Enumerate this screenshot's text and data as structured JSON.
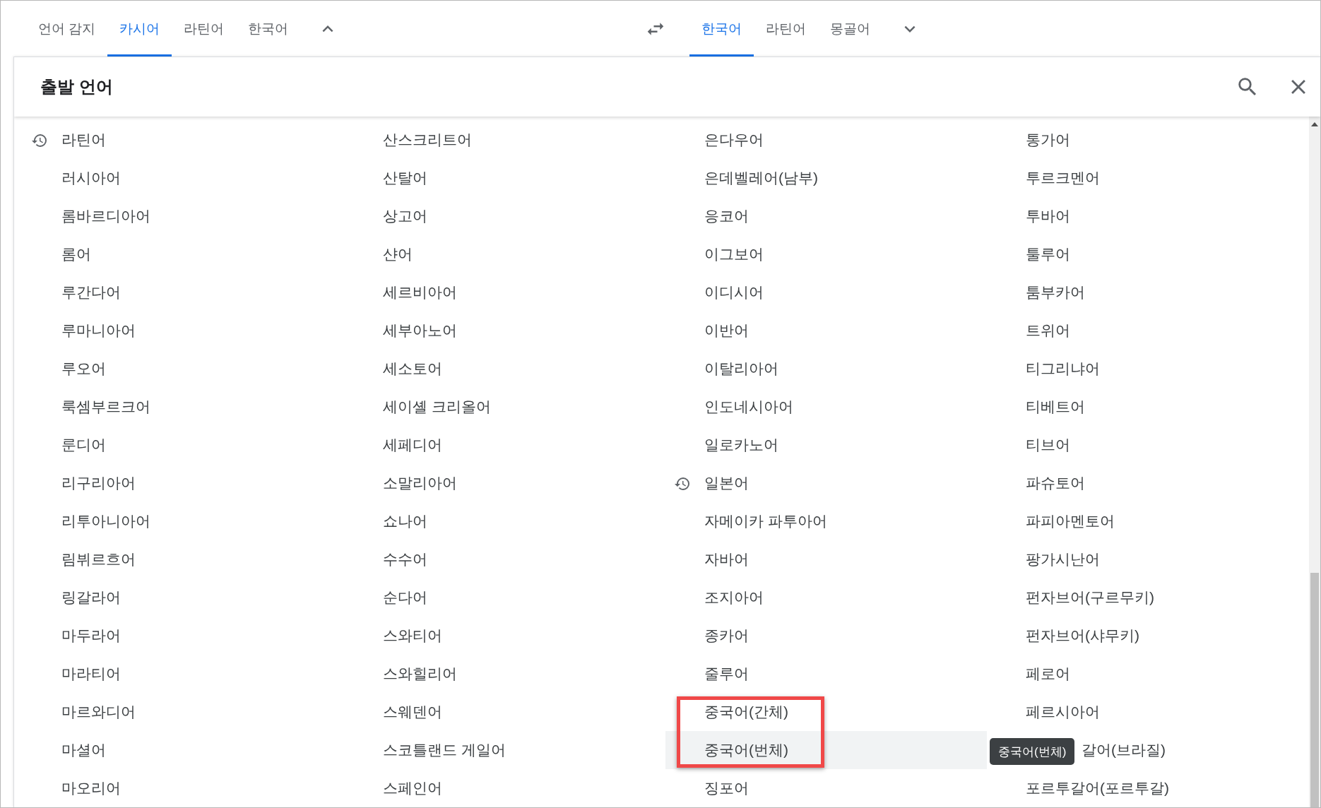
{
  "source_tabs": [
    {
      "label": "언어 감지",
      "selected": false
    },
    {
      "label": "카시어",
      "selected": true
    },
    {
      "label": "라틴어",
      "selected": false
    },
    {
      "label": "한국어",
      "selected": false
    }
  ],
  "target_tabs": [
    {
      "label": "한국어",
      "selected": true
    },
    {
      "label": "라틴어",
      "selected": false
    },
    {
      "label": "몽골어",
      "selected": false
    }
  ],
  "panel": {
    "title": "출발 언어"
  },
  "columns": [
    [
      {
        "label": "라틴어",
        "recent": true,
        "hovered": false,
        "boxed": false,
        "clipped": false
      },
      {
        "label": "러시아어",
        "recent": false,
        "hovered": false,
        "boxed": false,
        "clipped": false
      },
      {
        "label": "롬바르디아어",
        "recent": false,
        "hovered": false,
        "boxed": false,
        "clipped": false
      },
      {
        "label": "롬어",
        "recent": false,
        "hovered": false,
        "boxed": false,
        "clipped": false
      },
      {
        "label": "루간다어",
        "recent": false,
        "hovered": false,
        "boxed": false,
        "clipped": false
      },
      {
        "label": "루마니아어",
        "recent": false,
        "hovered": false,
        "boxed": false,
        "clipped": false
      },
      {
        "label": "루오어",
        "recent": false,
        "hovered": false,
        "boxed": false,
        "clipped": false
      },
      {
        "label": "룩셈부르크어",
        "recent": false,
        "hovered": false,
        "boxed": false,
        "clipped": false
      },
      {
        "label": "룬디어",
        "recent": false,
        "hovered": false,
        "boxed": false,
        "clipped": false
      },
      {
        "label": "리구리아어",
        "recent": false,
        "hovered": false,
        "boxed": false,
        "clipped": false
      },
      {
        "label": "리투아니아어",
        "recent": false,
        "hovered": false,
        "boxed": false,
        "clipped": false
      },
      {
        "label": "림뷔르흐어",
        "recent": false,
        "hovered": false,
        "boxed": false,
        "clipped": false
      },
      {
        "label": "링갈라어",
        "recent": false,
        "hovered": false,
        "boxed": false,
        "clipped": false
      },
      {
        "label": "마두라어",
        "recent": false,
        "hovered": false,
        "boxed": false,
        "clipped": false
      },
      {
        "label": "마라티어",
        "recent": false,
        "hovered": false,
        "boxed": false,
        "clipped": false
      },
      {
        "label": "마르와디어",
        "recent": false,
        "hovered": false,
        "boxed": false,
        "clipped": false
      },
      {
        "label": "마셜어",
        "recent": false,
        "hovered": false,
        "boxed": false,
        "clipped": false
      },
      {
        "label": "마오리어",
        "recent": false,
        "hovered": false,
        "boxed": false,
        "clipped": false
      }
    ],
    [
      {
        "label": "산스크리트어",
        "recent": false,
        "hovered": false,
        "boxed": false,
        "clipped": false
      },
      {
        "label": "산탈어",
        "recent": false,
        "hovered": false,
        "boxed": false,
        "clipped": false
      },
      {
        "label": "상고어",
        "recent": false,
        "hovered": false,
        "boxed": false,
        "clipped": false
      },
      {
        "label": "샨어",
        "recent": false,
        "hovered": false,
        "boxed": false,
        "clipped": false
      },
      {
        "label": "세르비아어",
        "recent": false,
        "hovered": false,
        "boxed": false,
        "clipped": false
      },
      {
        "label": "세부아노어",
        "recent": false,
        "hovered": false,
        "boxed": false,
        "clipped": false
      },
      {
        "label": "세소토어",
        "recent": false,
        "hovered": false,
        "boxed": false,
        "clipped": false
      },
      {
        "label": "세이셸 크리올어",
        "recent": false,
        "hovered": false,
        "boxed": false,
        "clipped": false
      },
      {
        "label": "세페디어",
        "recent": false,
        "hovered": false,
        "boxed": false,
        "clipped": false
      },
      {
        "label": "소말리아어",
        "recent": false,
        "hovered": false,
        "boxed": false,
        "clipped": false
      },
      {
        "label": "쇼나어",
        "recent": false,
        "hovered": false,
        "boxed": false,
        "clipped": false
      },
      {
        "label": "수수어",
        "recent": false,
        "hovered": false,
        "boxed": false,
        "clipped": false
      },
      {
        "label": "순다어",
        "recent": false,
        "hovered": false,
        "boxed": false,
        "clipped": false
      },
      {
        "label": "스와티어",
        "recent": false,
        "hovered": false,
        "boxed": false,
        "clipped": false
      },
      {
        "label": "스와힐리어",
        "recent": false,
        "hovered": false,
        "boxed": false,
        "clipped": false
      },
      {
        "label": "스웨덴어",
        "recent": false,
        "hovered": false,
        "boxed": false,
        "clipped": false
      },
      {
        "label": "스코틀랜드 게일어",
        "recent": false,
        "hovered": false,
        "boxed": false,
        "clipped": false
      },
      {
        "label": "스페인어",
        "recent": false,
        "hovered": false,
        "boxed": false,
        "clipped": false
      }
    ],
    [
      {
        "label": "은다우어",
        "recent": false,
        "hovered": false,
        "boxed": false,
        "clipped": false
      },
      {
        "label": "은데벨레어(남부)",
        "recent": false,
        "hovered": false,
        "boxed": false,
        "clipped": false
      },
      {
        "label": "응코어",
        "recent": false,
        "hovered": false,
        "boxed": false,
        "clipped": false
      },
      {
        "label": "이그보어",
        "recent": false,
        "hovered": false,
        "boxed": false,
        "clipped": false
      },
      {
        "label": "이디시어",
        "recent": false,
        "hovered": false,
        "boxed": false,
        "clipped": false
      },
      {
        "label": "이반어",
        "recent": false,
        "hovered": false,
        "boxed": false,
        "clipped": false
      },
      {
        "label": "이탈리아어",
        "recent": false,
        "hovered": false,
        "boxed": false,
        "clipped": false
      },
      {
        "label": "인도네시아어",
        "recent": false,
        "hovered": false,
        "boxed": false,
        "clipped": false
      },
      {
        "label": "일로카노어",
        "recent": false,
        "hovered": false,
        "boxed": false,
        "clipped": false
      },
      {
        "label": "일본어",
        "recent": true,
        "hovered": false,
        "boxed": false,
        "clipped": false
      },
      {
        "label": "자메이카 파투아어",
        "recent": false,
        "hovered": false,
        "boxed": false,
        "clipped": false
      },
      {
        "label": "자바어",
        "recent": false,
        "hovered": false,
        "boxed": false,
        "clipped": false
      },
      {
        "label": "조지아어",
        "recent": false,
        "hovered": false,
        "boxed": false,
        "clipped": false
      },
      {
        "label": "종카어",
        "recent": false,
        "hovered": false,
        "boxed": false,
        "clipped": false
      },
      {
        "label": "줄루어",
        "recent": false,
        "hovered": false,
        "boxed": false,
        "clipped": false
      },
      {
        "label": "중국어(간체)",
        "recent": false,
        "hovered": false,
        "boxed": true,
        "clipped": false
      },
      {
        "label": "중국어(번체)",
        "recent": false,
        "hovered": true,
        "boxed": true,
        "clipped": false,
        "tooltip": "중국어(번체)"
      },
      {
        "label": "징포어",
        "recent": false,
        "hovered": false,
        "boxed": false,
        "clipped": false
      }
    ],
    [
      {
        "label": "통가어",
        "recent": false,
        "hovered": false,
        "boxed": false,
        "clipped": false
      },
      {
        "label": "투르크멘어",
        "recent": false,
        "hovered": false,
        "boxed": false,
        "clipped": false
      },
      {
        "label": "투바어",
        "recent": false,
        "hovered": false,
        "boxed": false,
        "clipped": false
      },
      {
        "label": "툴루어",
        "recent": false,
        "hovered": false,
        "boxed": false,
        "clipped": false
      },
      {
        "label": "툼부카어",
        "recent": false,
        "hovered": false,
        "boxed": false,
        "clipped": false
      },
      {
        "label": "트위어",
        "recent": false,
        "hovered": false,
        "boxed": false,
        "clipped": false
      },
      {
        "label": "티그리냐어",
        "recent": false,
        "hovered": false,
        "boxed": false,
        "clipped": false
      },
      {
        "label": "티베트어",
        "recent": false,
        "hovered": false,
        "boxed": false,
        "clipped": false
      },
      {
        "label": "티브어",
        "recent": false,
        "hovered": false,
        "boxed": false,
        "clipped": false
      },
      {
        "label": "파슈토어",
        "recent": false,
        "hovered": false,
        "boxed": false,
        "clipped": false
      },
      {
        "label": "파피아멘토어",
        "recent": false,
        "hovered": false,
        "boxed": false,
        "clipped": false
      },
      {
        "label": "팡가시난어",
        "recent": false,
        "hovered": false,
        "boxed": false,
        "clipped": false
      },
      {
        "label": "펀자브어(구르무키)",
        "recent": false,
        "hovered": false,
        "boxed": false,
        "clipped": false
      },
      {
        "label": "펀자브어(샤무키)",
        "recent": false,
        "hovered": false,
        "boxed": false,
        "clipped": false
      },
      {
        "label": "페로어",
        "recent": false,
        "hovered": false,
        "boxed": false,
        "clipped": false
      },
      {
        "label": "페르시아어",
        "recent": false,
        "hovered": false,
        "boxed": false,
        "clipped": false
      },
      {
        "label": "갈어(브라질)",
        "recent": false,
        "hovered": false,
        "boxed": false,
        "clipped": true
      },
      {
        "label": "포르투갈어(포르투갈)",
        "recent": false,
        "hovered": false,
        "boxed": false,
        "clipped": false
      }
    ]
  ]
}
